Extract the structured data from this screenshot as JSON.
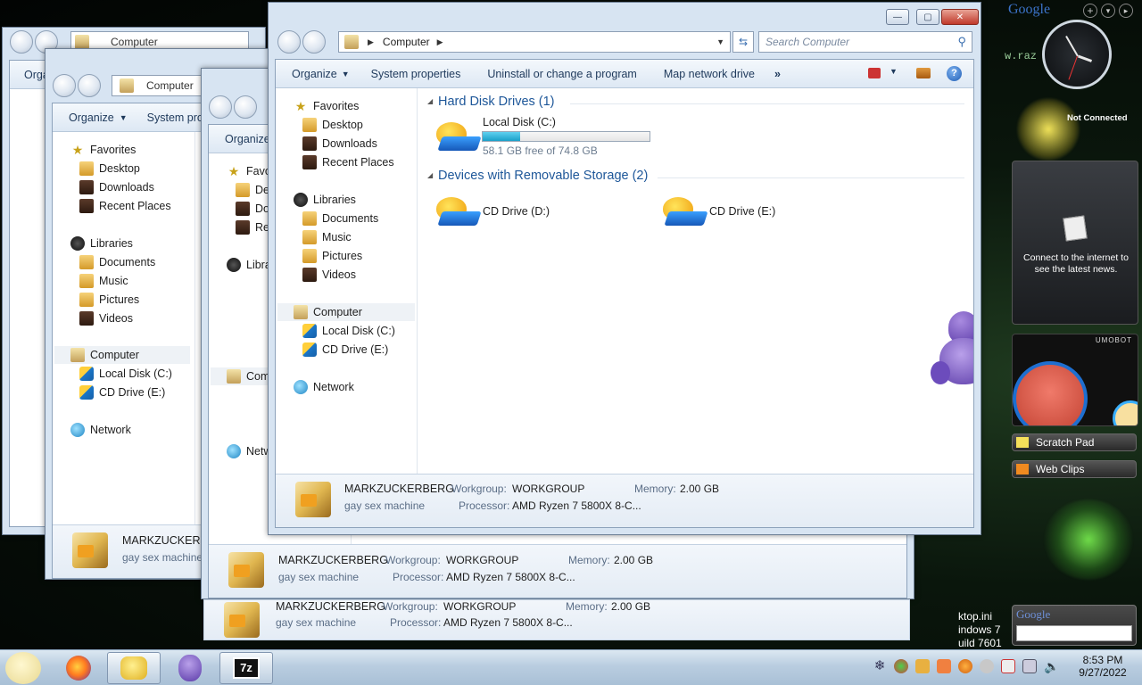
{
  "colors": {
    "accent": "#1e395b",
    "heading": "#1e5799",
    "progress": "#1aa0c8",
    "close": "#c0392b"
  },
  "explorer": {
    "breadcrumb": "Computer",
    "search_placeholder": "Search Computer",
    "toolbar": {
      "organize": "Organize",
      "system_properties": "System properties",
      "uninstall": "Uninstall or change a program",
      "map_drive": "Map network drive",
      "more": "»"
    },
    "nav": {
      "favorites": "Favorites",
      "desktop": "Desktop",
      "downloads": "Downloads",
      "recent": "Recent Places",
      "libraries": "Libraries",
      "documents": "Documents",
      "music": "Music",
      "pictures": "Pictures",
      "videos": "Videos",
      "computer": "Computer",
      "local_disk": "Local Disk (C:)",
      "cd_drive": "CD Drive (E:)",
      "network": "Network"
    },
    "sections": {
      "hard_disks": "Hard Disk Drives (1)",
      "removable": "Devices with Removable Storage (2)"
    },
    "drives": {
      "local_disk": {
        "name": "Local Disk (C:)",
        "free": "58.1 GB free of 74.8 GB",
        "used_fraction": 0.223
      },
      "cd_d": "CD Drive (D:)",
      "cd_e": "CD Drive (E:)"
    },
    "details": {
      "computer_name": "MARKZUCKERBERG",
      "description": "gay sex machine",
      "workgroup_label": "Workgroup:",
      "workgroup": "WORKGROUP",
      "memory_label": "Memory:",
      "memory": "2.00 GB",
      "processor_label": "Processor:",
      "processor": "AMD Ryzen 7 5800X 8-C..."
    }
  },
  "gadgets": {
    "google_logo": "Google",
    "not_connected": "Not Connected",
    "news_message": "Connect to the internet to see the latest news.",
    "scratch_pad": "Scratch Pad",
    "web_clips": "Web Clips",
    "google_search_logo": "Google",
    "umobot": "UMOBOT",
    "desktop_text_1": "ktop.ini",
    "desktop_text_2": "indows 7",
    "desktop_text_3": "uild 7601",
    "razer_text": "w.raz"
  },
  "taskbar": {
    "time": "8:53 PM",
    "date": "9/27/2022",
    "app_7z": "7z"
  }
}
